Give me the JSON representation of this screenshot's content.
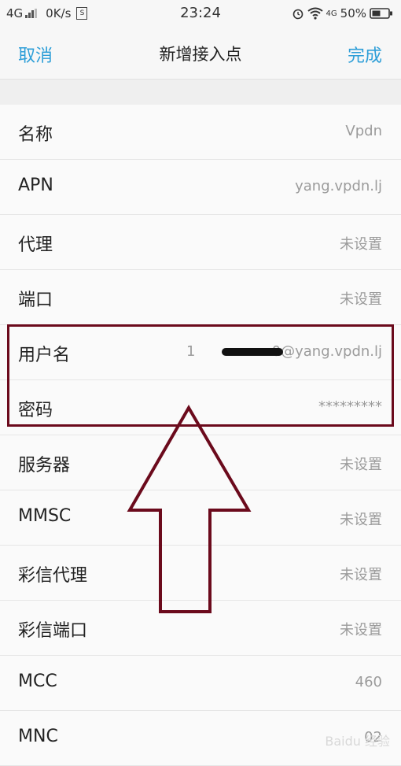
{
  "status": {
    "network": "4G",
    "speed": "0K/s",
    "time": "23:24",
    "net_right": "4G",
    "battery": "50%"
  },
  "nav": {
    "cancel": "取消",
    "title": "新增接入点",
    "done": "完成"
  },
  "rows": [
    {
      "label": "名称",
      "value": "Vpdn"
    },
    {
      "label": "APN",
      "value": "yang.vpdn.lj"
    },
    {
      "label": "代理",
      "value": "未设置"
    },
    {
      "label": "端口",
      "value": "未设置"
    },
    {
      "label": "用户名",
      "value": "1                 0@yang.vpdn.lj"
    },
    {
      "label": "密码",
      "value": "*********"
    },
    {
      "label": "服务器",
      "value": "未设置"
    },
    {
      "label": "MMSC",
      "value": "未设置"
    },
    {
      "label": "彩信代理",
      "value": "未设置"
    },
    {
      "label": "彩信端口",
      "value": "未设置"
    },
    {
      "label": "MCC",
      "value": "460"
    },
    {
      "label": "MNC",
      "value": "02"
    }
  ],
  "watermark": "Baidu 经验",
  "colors": {
    "accent": "#2f9fd8",
    "annotation": "#6b0a1c"
  }
}
